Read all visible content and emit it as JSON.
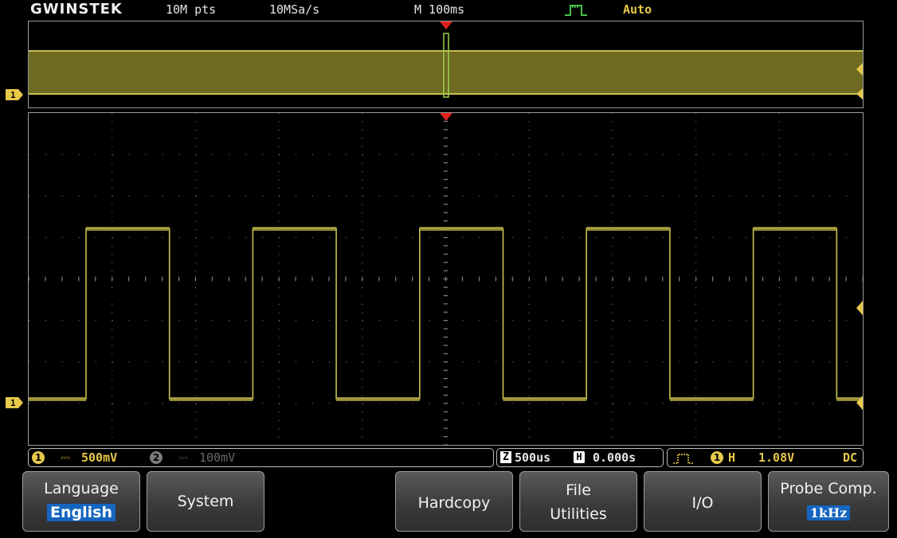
{
  "topbar": {
    "brand": "GWINSTEK",
    "record_length": "10M pts",
    "sample_rate": "10MSa/s",
    "horizontal": "M 100ms",
    "trigger_icon": "trigger-edge-pulse-icon",
    "trigger_mode": "Auto"
  },
  "colors": {
    "channel1": "#c8c050",
    "accent_blue": "#1565c0",
    "trigger_marker": "#e02020",
    "trigger_mode": "#e6c84a"
  },
  "waveform": {
    "type": "square",
    "periods_visible": 5,
    "frequency": "1kHz"
  },
  "markers": {
    "channel1_label": "1"
  },
  "infobar": {
    "ch1_number": "1",
    "ch1_coupling_icon": "dc-coupling-icon",
    "ch1_scale": "500mV",
    "ch2_number": "2",
    "ch2_scale": "100mV",
    "zoom_label": "Z",
    "zoom_scale": "500us",
    "position_label": "H",
    "position_value": "0.000s",
    "trigger_source": "1",
    "trigger_h": "H",
    "trigger_level": "1.08V",
    "trigger_coupling": "DC"
  },
  "softkeys": [
    {
      "line1": "Language",
      "line2": "English"
    },
    {
      "line1": "System",
      "line2": ""
    },
    {
      "line1": "",
      "line2": ""
    },
    {
      "line1": "Hardcopy",
      "line2": ""
    },
    {
      "line1": "File",
      "line2": "Utilities"
    },
    {
      "line1": "I/O",
      "line2": ""
    },
    {
      "line1": "Probe Comp.",
      "line2": "1kHz"
    }
  ]
}
